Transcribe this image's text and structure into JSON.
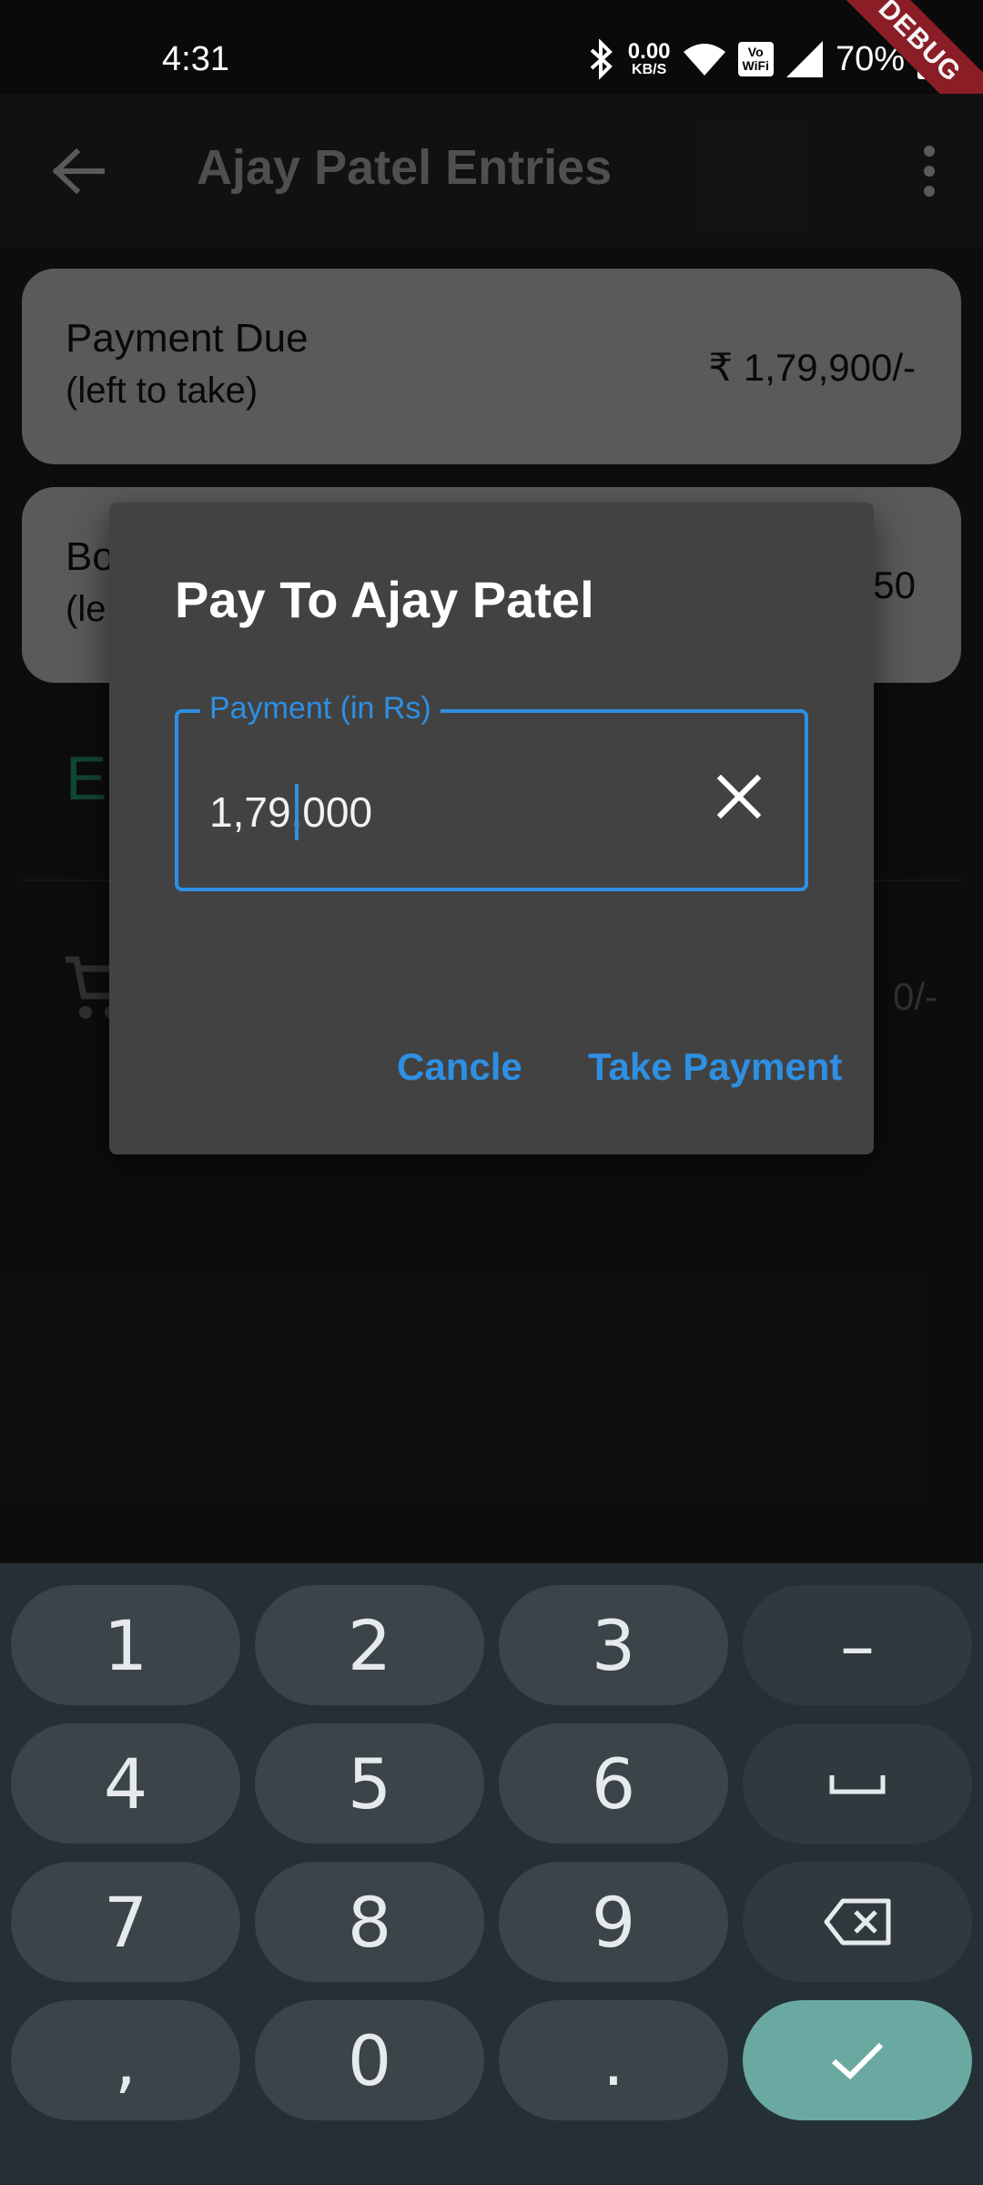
{
  "status_bar": {
    "time": "4:31",
    "net_speed_value": "0.00",
    "net_speed_unit": "KB/S",
    "vowifi_top": "Vo",
    "vowifi_bottom": "WiFi",
    "battery": "70%",
    "debug_banner": "DEBUG"
  },
  "app_bar": {
    "title": "Ajay Patel Entries",
    "back_icon": "arrow-back-icon",
    "menu_icon": "more-vert-icon"
  },
  "cards": [
    {
      "label": "Payment Due",
      "sub": "(left to take)",
      "amount": "₹ 1,79,900/-"
    },
    {
      "label": "Bo",
      "sub": "(le",
      "amount": "50"
    }
  ],
  "section": {
    "heading_partial": "E"
  },
  "entry": {
    "icon": "cart-icon",
    "amount_partial": "0/-"
  },
  "dialog": {
    "title": "Pay To Ajay Patel",
    "field_label": "Payment (in Rs)",
    "field_value": "1,79,000",
    "clear_icon": "close-icon",
    "cancel_label": "Cancle",
    "confirm_label": "Take Payment"
  },
  "keyboard": {
    "rows": [
      [
        "1",
        "2",
        "3",
        "–"
      ],
      [
        "4",
        "5",
        "6",
        "space"
      ],
      [
        "7",
        "8",
        "9",
        "backspace"
      ],
      [
        ",",
        "0",
        ".",
        "done"
      ]
    ]
  },
  "colors": {
    "accent": "#2e8fe3",
    "dialog_bg": "#424242",
    "card_bg": "#8a8a8a",
    "keyboard_bg": "#253035",
    "enter_key": "#6aa9a2",
    "debug_ribbon": "#8b1d26"
  }
}
